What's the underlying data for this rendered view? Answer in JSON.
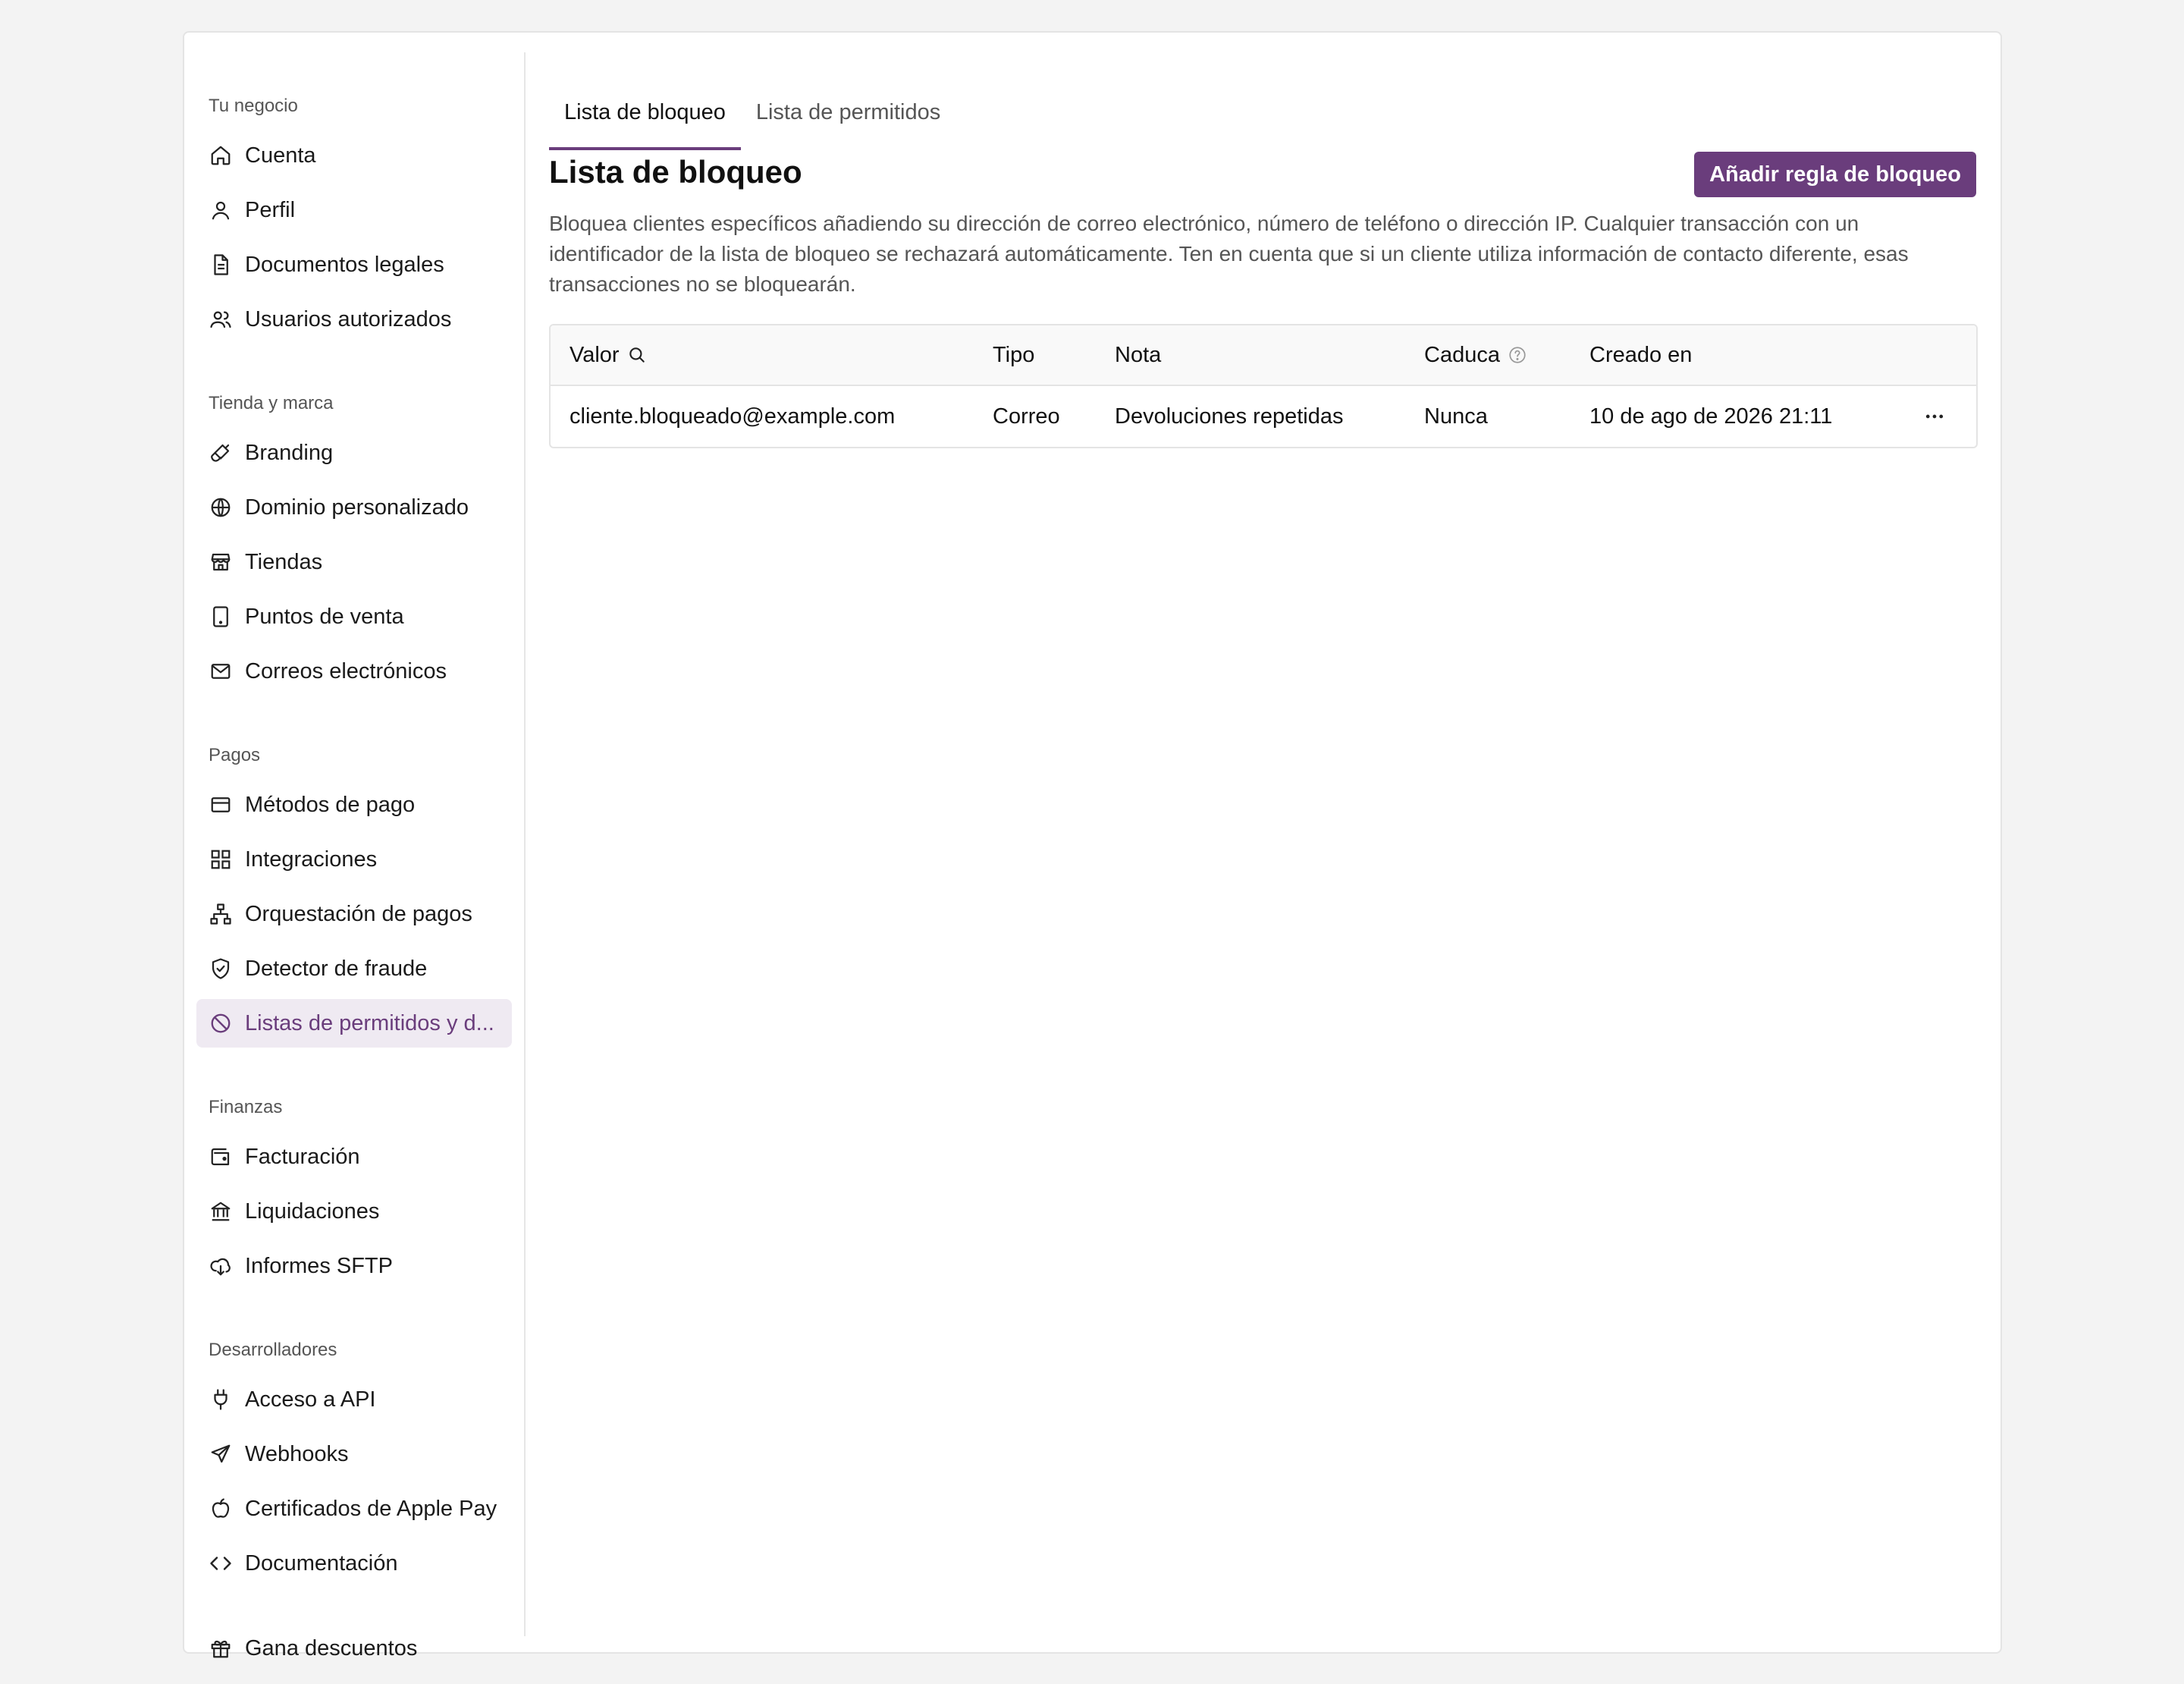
{
  "sidebar": {
    "groups": [
      {
        "label": "Tu negocio"
      },
      {
        "label": "Tienda y marca"
      },
      {
        "label": "Pagos"
      },
      {
        "label": "Finanzas"
      },
      {
        "label": "Desarrolladores"
      }
    ],
    "items": [
      {
        "label": "Cuenta",
        "icon": "home-icon"
      },
      {
        "label": "Perfil",
        "icon": "user-icon"
      },
      {
        "label": "Documentos legales",
        "icon": "document-icon"
      },
      {
        "label": "Usuarios autorizados",
        "icon": "users-icon"
      },
      {
        "label": "Branding",
        "icon": "brush-icon"
      },
      {
        "label": "Dominio personalizado",
        "icon": "globe-icon"
      },
      {
        "label": "Tiendas",
        "icon": "store-icon"
      },
      {
        "label": "Puntos de venta",
        "icon": "tablet-icon"
      },
      {
        "label": "Correos electrónicos",
        "icon": "mail-icon"
      },
      {
        "label": "Métodos de pago",
        "icon": "credit-card-icon"
      },
      {
        "label": "Integraciones",
        "icon": "grid-icon"
      },
      {
        "label": "Orquestación de pagos",
        "icon": "network-icon"
      },
      {
        "label": "Detector de fraude",
        "icon": "shield-check-icon"
      },
      {
        "label": "Listas de permitidos y d...",
        "icon": "ban-icon",
        "active": true
      },
      {
        "label": "Facturación",
        "icon": "wallet-icon"
      },
      {
        "label": "Liquidaciones",
        "icon": "bank-icon"
      },
      {
        "label": "Informes SFTP",
        "icon": "cloud-download-icon"
      },
      {
        "label": "Acceso a API",
        "icon": "plug-icon"
      },
      {
        "label": "Webhooks",
        "icon": "send-icon"
      },
      {
        "label": "Certificados de Apple Pay",
        "icon": "apple-icon"
      },
      {
        "label": "Documentación",
        "icon": "code-icon"
      },
      {
        "label": "Gana descuentos",
        "icon": "gift-icon"
      }
    ]
  },
  "tabs": [
    {
      "label": "Lista de bloqueo",
      "active": true
    },
    {
      "label": "Lista de permitidos",
      "active": false
    }
  ],
  "page": {
    "title": "Lista de bloqueo",
    "add_button": "Añadir regla de bloqueo",
    "description": "Bloquea clientes específicos añadiendo su dirección de correo electrónico, número de teléfono o dirección IP. Cualquier transacción con un identificador de la lista de bloqueo se rechazará automáticamente. Ten en cuenta que si un cliente utiliza información de contacto diferente, esas transacciones no se bloquearán."
  },
  "table": {
    "headers": {
      "valor": "Valor",
      "tipo": "Tipo",
      "nota": "Nota",
      "caduca": "Caduca",
      "creado": "Creado en"
    },
    "rows": [
      {
        "valor": "cliente.bloqueado@example.com",
        "tipo": "Correo",
        "nota": "Devoluciones repetidas",
        "caduca": "Nunca",
        "creado": "10 de ago de 2026 21:11"
      }
    ]
  },
  "colors": {
    "accent": "#6a3d7c",
    "active_bg": "#efeaf2",
    "background": "#f3f3f3"
  }
}
